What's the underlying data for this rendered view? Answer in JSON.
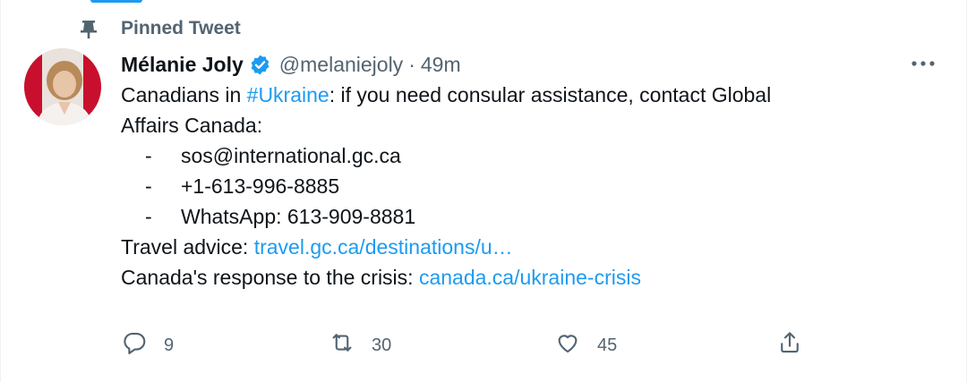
{
  "pinned": {
    "label": "Pinned Tweet",
    "icon": "pin-icon"
  },
  "author": {
    "name": "Mélanie Joly",
    "handle": "@melaniejoly",
    "separator": "·",
    "time": "49m",
    "verified_icon": "verified-badge-icon",
    "verified_color": "#1d9bf0"
  },
  "tweet": {
    "intro_before": "Canadians in ",
    "hashtag": "#Ukraine",
    "intro_after": ": if you need consular assistance, contact Global",
    "intro_line2": "Affairs Canada:",
    "bullet_dash": "-",
    "bullets": [
      "sos@international.gc.ca",
      "+1-613-996-8885",
      "WhatsApp: 613-909-8881"
    ],
    "travel_label": "Travel advice: ",
    "travel_link": "travel.gc.ca/destinations/u…",
    "response_label": "Canada's response to the crisis: ",
    "response_link": "canada.ca/ukraine-crisis"
  },
  "actions": {
    "reply": {
      "icon": "reply-icon",
      "count": "9"
    },
    "retweet": {
      "icon": "retweet-icon",
      "count": "30"
    },
    "like": {
      "icon": "heart-icon",
      "count": "45"
    },
    "share": {
      "icon": "share-icon"
    }
  },
  "more_icon": "more-options-icon",
  "colors": {
    "link": "#1d9bf0",
    "secondary_text": "#536471",
    "primary_text": "#0f1419"
  }
}
